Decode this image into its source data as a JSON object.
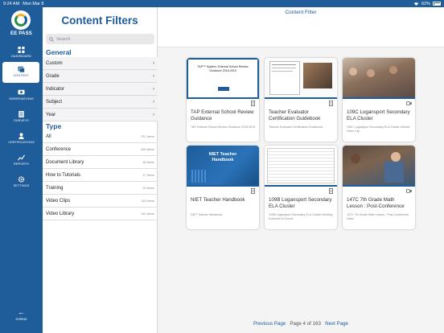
{
  "status_bar": {
    "time": "9:24 AM",
    "date": "Mon Mar 8",
    "battery": "62%"
  },
  "rail": {
    "logo_text": "EE PASS",
    "items": [
      {
        "label": "DASHBOARD",
        "icon": "grid-icon"
      },
      {
        "label": "CONTENT",
        "icon": "content-icon",
        "active": true
      },
      {
        "label": "OBSERVATIONS",
        "icon": "observations-icon"
      },
      {
        "label": "SURVEYS",
        "icon": "surveys-icon"
      },
      {
        "label": "CERTIFICATIONS",
        "icon": "certifications-icon"
      },
      {
        "label": "REPORTS",
        "icon": "reports-icon"
      },
      {
        "label": "SETTINGS",
        "icon": "gear-icon"
      }
    ],
    "shrink_label": "SHRINK"
  },
  "filters": {
    "title": "Content Filters",
    "search_placeholder": "Search",
    "general_title": "General",
    "general": [
      "Custom",
      "Grade",
      "Indicator",
      "Subject",
      "Year"
    ],
    "type_title": "Type",
    "types": [
      {
        "label": "All",
        "count": "971 Items"
      },
      {
        "label": "Conference",
        "count": "626 Items"
      },
      {
        "label": "Document Library",
        "count": "46 Items"
      },
      {
        "label": "How to Tutorials",
        "count": "17 Items"
      },
      {
        "label": "Training",
        "count": "22 Items"
      },
      {
        "label": "Video Clips",
        "count": "116 Items"
      },
      {
        "label": "Video Library",
        "count": "144 Items"
      }
    ]
  },
  "main": {
    "title": "Content Filter",
    "cards": [
      {
        "title": "TAP External School Review Guidance",
        "sub": "TAP External School Review Guidance 2018-2019",
        "icon": "document-icon",
        "thumb_text": "TAP™ System: External School Review Guidance 2018-2019"
      },
      {
        "title": "Teacher Evaluator Certification Guidebook",
        "sub": "Teacher Evaluator Certification Guidebook",
        "icon": "document-icon"
      },
      {
        "title": "109C Logansport Secondary ELA Cluster",
        "sub": "109C Logansport Secondary ELA Cluster Debrief Video Clip",
        "icon": "video-icon"
      },
      {
        "title": "NIET Teacher Handbook",
        "sub": "NIET Teacher Handbook",
        "icon": "document-icon",
        "thumb_text": "NIET Teacher Handbook"
      },
      {
        "title": "109B Logansport Secondary ELA Cluster",
        "sub": "109B Logansport Secondary ELA Cluster Meeting Evidence & Scores",
        "icon": "document-icon"
      },
      {
        "title": "147C 7th Grade Math Lesson : Post-Conference",
        "sub": "147C 7th Grade Math Lesson - Post-Conference Video",
        "icon": "video-icon"
      }
    ],
    "pager": {
      "prev": "Previous Page",
      "info": "Page 4 of 163",
      "next": "Next Page"
    }
  },
  "colors": {
    "brand": "#1f5c9a",
    "accent_green": "#2a8f4a"
  }
}
